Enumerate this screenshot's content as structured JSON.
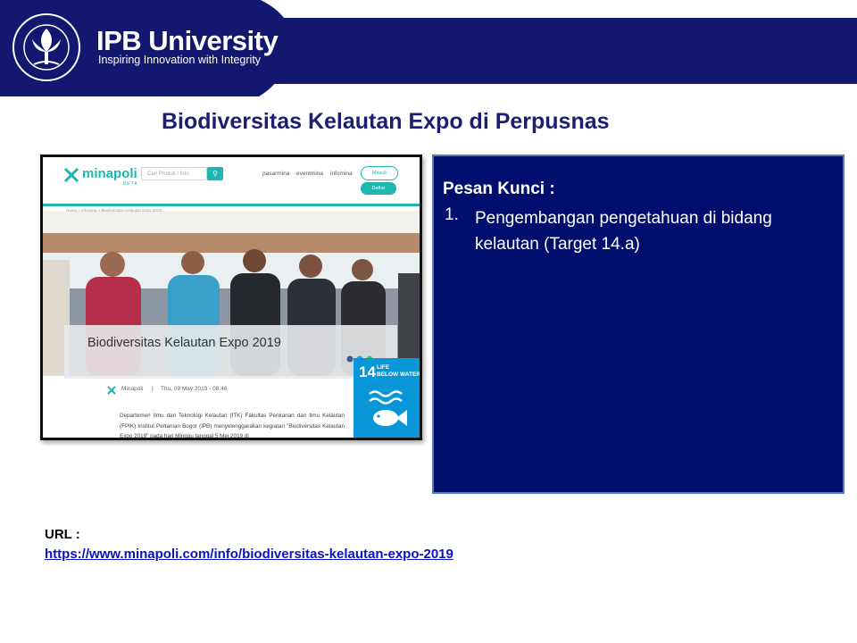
{
  "header": {
    "brand_title": "IPB University",
    "brand_tagline": "Inspiring Innovation with Integrity",
    "seal_text": "INSTITUT PERTANIAN BOGOR",
    "colors": {
      "navy": "#12176f",
      "white": "#ffffff"
    }
  },
  "slide": {
    "title": "Biodiversitas Kelautan Expo di Perpusnas"
  },
  "screenshot": {
    "site_logo": "minapoli",
    "site_logo_sub": "BETA",
    "search_placeholder": "Cari Produk / Info",
    "search_icon": "search-icon",
    "nav": [
      "pasarmina",
      "eventmina",
      "infomina"
    ],
    "login_label": "Masuk",
    "register_label": "Daftar",
    "breadcrumb": "Home  >  Infomina  >  Biodiversitas Kelautan Expo 2019",
    "article_title": "Biodiversitas Kelautan Expo 2019",
    "author": "Minapoli",
    "date": "Thu, 09 May 2019 - 08:46",
    "article_text": "Departemen Ilmu dan Teknologi Kelautan (ITK) Fakultas Perikanan dan Ilmu Kelautan (FPIK) Institut Pertanian Bogor (IPB) menyelenggarakan kegiatan \"Biodiversitas Kelautan Expo 2019\" pada hari Minggu tanggal 5 Mei 2019 di",
    "sdg": {
      "number": "14",
      "label_line1": "LIFE",
      "label_line2": "BELOW WATER",
      "color": "#0a97d9"
    }
  },
  "key_message": {
    "heading": "Pesan Kunci :",
    "items": [
      {
        "number": "1.",
        "text": "Pengembangan pengetahuan di bidang kelautan (Target 14.a)"
      }
    ],
    "background": "#000e6e"
  },
  "footer": {
    "url_label": "URL :",
    "url": "https://www.minapoli.com/info/biodiversitas-kelautan-expo-2019"
  }
}
